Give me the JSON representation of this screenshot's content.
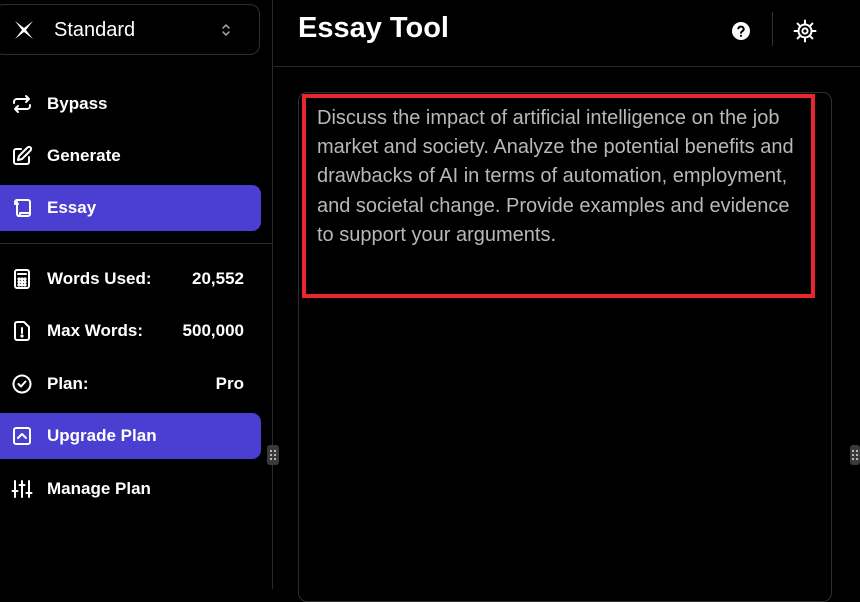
{
  "sidebar": {
    "mode_selector": {
      "label": "Standard"
    },
    "nav": [
      {
        "label": "Bypass",
        "icon": "swap-arrows-icon"
      },
      {
        "label": "Generate",
        "icon": "edit-icon"
      },
      {
        "label": "Essay",
        "icon": "scroll-icon",
        "active": true
      }
    ],
    "stats": [
      {
        "label": "Words Used:",
        "value": "20,552",
        "icon": "calculator-icon"
      },
      {
        "label": "Max Words:",
        "value": "500,000",
        "icon": "alert-file-icon"
      },
      {
        "label": "Plan:",
        "value": "Pro",
        "icon": "check-circle-icon"
      }
    ],
    "upgrade_label": "Upgrade Plan",
    "manage_label": "Manage Plan"
  },
  "header": {
    "title": "Essay Tool"
  },
  "editor": {
    "prompt": "Discuss the impact of artificial intelligence on the job market and society. Analyze the potential benefits and drawbacks of AI in terms of automation, employment, and societal change. Provide examples and evidence to support your arguments."
  },
  "colors": {
    "accent": "#4a3fd1",
    "highlight": "#e8262e",
    "background": "#000000"
  }
}
